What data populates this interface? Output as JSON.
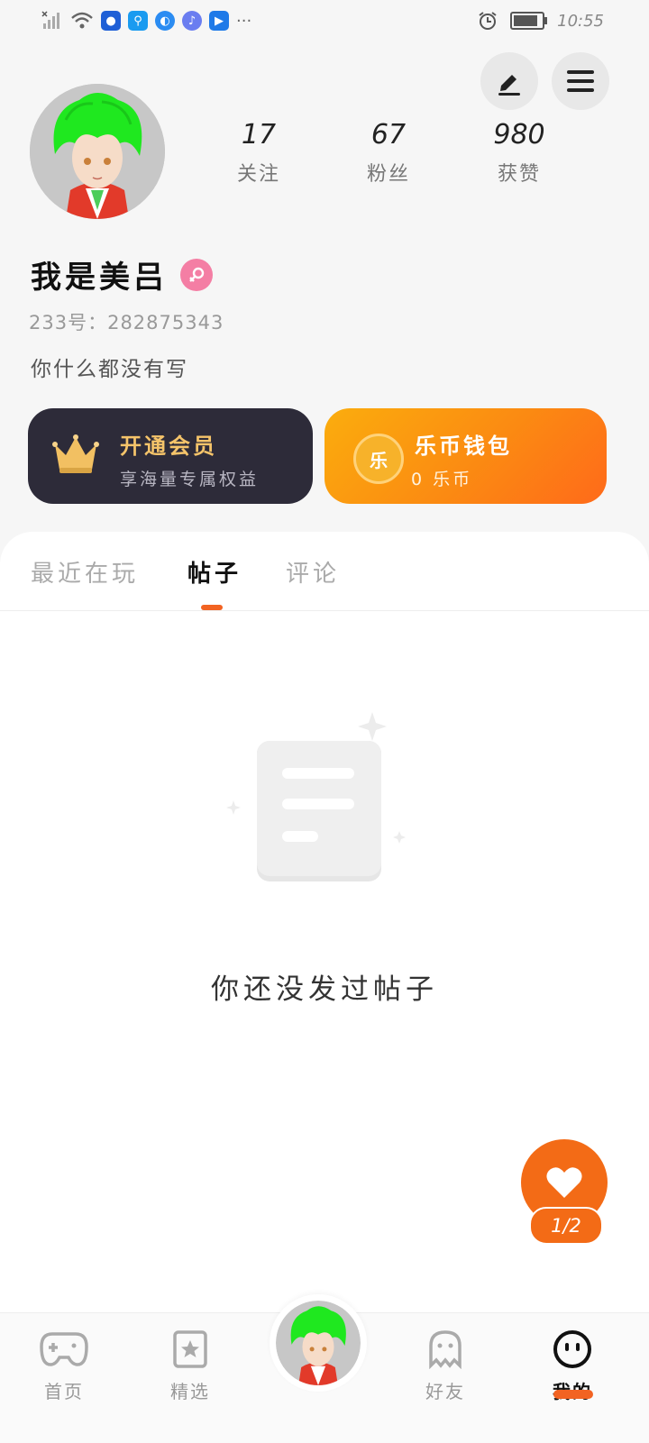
{
  "status_bar": {
    "time": "10:55",
    "more_label": "···"
  },
  "profile": {
    "stats": [
      {
        "value": "17",
        "label": "关注"
      },
      {
        "value": "67",
        "label": "粉丝"
      },
      {
        "value": "980",
        "label": "获赞"
      }
    ],
    "username": "我是美吕",
    "gender_icon": "female-icon",
    "uid": "233号：282875343",
    "bio": "你什么都没有写"
  },
  "cards": {
    "vip": {
      "title": "开通会员",
      "subtitle": "享海量专属权益",
      "icon": "crown-icon"
    },
    "coin": {
      "title": "乐币钱包",
      "subtitle": "0 乐币",
      "icon_text": "乐"
    }
  },
  "tabs": [
    {
      "label": "最近在玩",
      "active": false
    },
    {
      "label": "帖子",
      "active": true
    },
    {
      "label": "评论",
      "active": false
    }
  ],
  "empty_state": {
    "text": "你还没发过帖子"
  },
  "fab": {
    "badge": "1/2",
    "icon": "heart-icon"
  },
  "bottom_nav": [
    {
      "label": "首页",
      "icon": "gamepad-icon",
      "active": false
    },
    {
      "label": "精选",
      "icon": "star-bookmark-icon",
      "active": false
    },
    {
      "label": "",
      "icon": "avatar-center",
      "active": false
    },
    {
      "label": "好友",
      "icon": "ghost-icon",
      "active": false
    },
    {
      "label": "我的",
      "icon": "face-icon",
      "active": true
    }
  ],
  "colors": {
    "accent": "#f26322",
    "vip_card_bg": "#2d2b39",
    "vip_gold": "#f5c46a",
    "female_pink": "#f47ea4"
  }
}
